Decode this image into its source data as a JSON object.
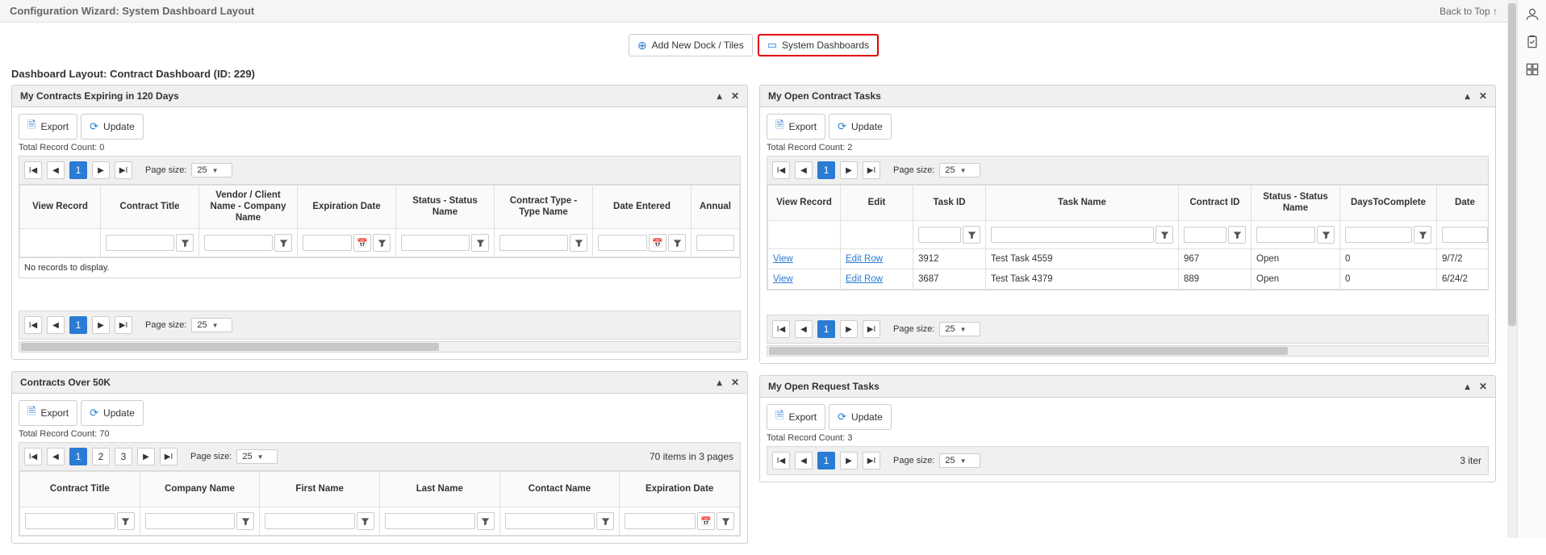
{
  "header": {
    "title": "Configuration Wizard: System Dashboard Layout",
    "backToTop": "Back to Top ↑"
  },
  "toolbar": {
    "addNew": "Add New Dock / Tiles",
    "systemDashboards": "System Dashboards"
  },
  "subheader": "Dashboard Layout: Contract Dashboard (ID: 229)",
  "common": {
    "export": "Export",
    "update": "Update",
    "pageSizeLabel": "Page size:",
    "pageSize": "25",
    "recordCountPrefix": "Total Record Count: ",
    "noRecords": "No records to display.",
    "viewLink": "View",
    "editRowLink": "Edit Row"
  },
  "panels": {
    "expiring": {
      "title": "My Contracts Expiring in 120 Days",
      "recordCount": "0",
      "columns": [
        "View Record",
        "Contract Title",
        "Vendor / Client Name - Company Name",
        "Expiration Date",
        "Status - Status Name",
        "Contract Type - Type Name",
        "Date Entered",
        "Annual"
      ]
    },
    "openContractTasks": {
      "title": "My Open Contract Tasks",
      "recordCount": "2",
      "columns": [
        "View Record",
        "Edit",
        "Task ID",
        "Task Name",
        "Contract ID",
        "Status - Status Name",
        "DaysToComplete",
        "Date"
      ],
      "rows": [
        {
          "taskId": "3912",
          "taskName": "Test Task 4559",
          "contractId": "967",
          "status": "Open",
          "days": "0",
          "date": "9/7/2"
        },
        {
          "taskId": "3687",
          "taskName": "Test Task 4379",
          "contractId": "889",
          "status": "Open",
          "days": "0",
          "date": "6/24/2"
        }
      ]
    },
    "over50k": {
      "title": "Contracts Over 50K",
      "recordCount": "70",
      "pages": [
        "1",
        "2",
        "3"
      ],
      "pagerInfo": "70 items in 3 pages",
      "columns": [
        "Contract Title",
        "Company Name",
        "First Name",
        "Last Name",
        "Contact Name",
        "Expiration Date"
      ]
    },
    "openRequestTasks": {
      "title": "My Open Request Tasks",
      "recordCount": "3",
      "pagerInfo": "3 iter"
    }
  }
}
